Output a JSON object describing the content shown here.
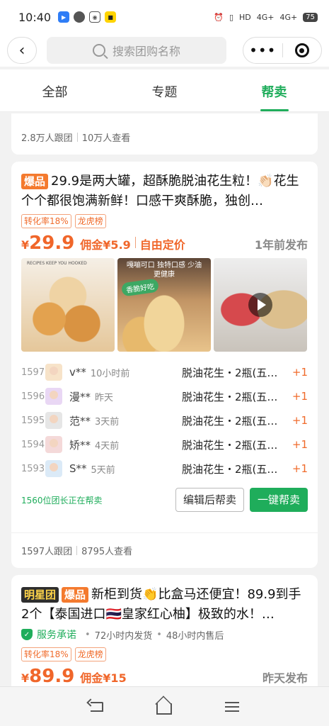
{
  "status_bar": {
    "time": "10:40",
    "indicators": [
      "HD",
      "4G+",
      "4G+"
    ],
    "battery": "75"
  },
  "top_bar": {
    "search_placeholder": "搜索团购名称",
    "more_label": "•••"
  },
  "tabs": [
    {
      "label": "全部",
      "active": false
    },
    {
      "label": "专题",
      "active": false
    },
    {
      "label": "帮卖",
      "active": true
    }
  ],
  "card0": {
    "stats": [
      "2.8万人跟团",
      "10万人查看"
    ]
  },
  "card1": {
    "badge": "爆品",
    "title": "29.9是两大罐，超酥脆脱油花生粒！👏🏻花生个个都很饱满新鲜！口感干爽酥脆，独创…",
    "tags": [
      "转化率18%",
      "龙虎榜"
    ],
    "price_symbol": "¥",
    "price": "29.9",
    "commission": "佣金¥5.9",
    "pricing_mode": "自由定价",
    "published": "1年前发布",
    "image_texts": {
      "img1_caption": "RECIPES KEEP YOU HOOKED",
      "img2_caption": "嘎嘣可口 独特口感 少油更健康",
      "img2_pill": "香脆好吃"
    },
    "orders": [
      {
        "num": "1597",
        "name": "v**",
        "when": "10小时前",
        "product": "脱油花生・2瓶(五…",
        "qty": "+1"
      },
      {
        "num": "1596",
        "name": "漫**",
        "when": "昨天",
        "product": "脱油花生・2瓶(五…",
        "qty": "+1"
      },
      {
        "num": "1595",
        "name": "范**",
        "when": "3天前",
        "product": "脱油花生・2瓶(五…",
        "qty": "+1"
      },
      {
        "num": "1594",
        "name": "矫**",
        "when": "4天前",
        "product": "脱油花生・2瓶(五…",
        "qty": "+1"
      },
      {
        "num": "1593",
        "name": "S**",
        "when": "5天前",
        "product": "脱油花生・2瓶(五…",
        "qty": "+1"
      }
    ],
    "sellers_text": "1560位团长正在帮卖",
    "edit_button": "编辑后帮卖",
    "sell_button": "一键帮卖",
    "stats": [
      "1597人跟团",
      "8795人查看"
    ]
  },
  "card2": {
    "badge_star": "明星团",
    "badge_hot": "爆品",
    "title": "新柜到货👏比盒马还便宜！89.9到手2个【泰国进口🇹🇭皇家红心柚】极致的水！…",
    "service_label": "服务承诺",
    "services": [
      "72小时内发货",
      "48小时内售后"
    ],
    "tags": [
      "转化率18%",
      "龙虎榜"
    ],
    "price_symbol": "¥",
    "price": "89.9",
    "commission": "佣金¥15",
    "published": "昨天发布"
  },
  "colors": {
    "accent_green": "#1fad5b",
    "price_orange": "#f0662a",
    "hot_badge": "#f47a2e"
  }
}
